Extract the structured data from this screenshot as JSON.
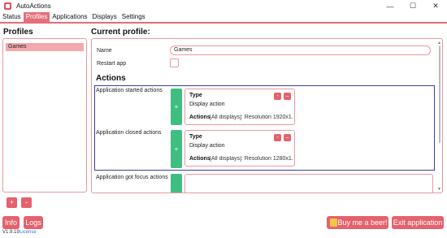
{
  "window": {
    "title": "AutoActions"
  },
  "menu": {
    "items": [
      {
        "label": "Status"
      },
      {
        "label": "Profiles"
      },
      {
        "label": "Applications"
      },
      {
        "label": "Displays"
      },
      {
        "label": "Settings"
      }
    ],
    "active_index": 1
  },
  "profiles": {
    "heading": "Profiles",
    "items": [
      {
        "label": "Games"
      }
    ],
    "add_label": "+",
    "remove_label": "-"
  },
  "current_profile": {
    "heading": "Current profile:",
    "name_label": "Name",
    "name_value": "Games",
    "restart_label": "Restart app",
    "restart_checked": false,
    "actions_heading": "Actions",
    "groups": [
      {
        "label": "Application started actions",
        "add_label": "+",
        "card": {
          "type_label": "Type",
          "type_value": "Display action",
          "actions_label": "Actions",
          "actions_value": "[All displays]: Resolution 1920x1...",
          "minus_label": "-",
          "collapse_label": "–"
        }
      },
      {
        "label": "Application closed actions",
        "add_label": "+",
        "card": {
          "type_label": "Type",
          "type_value": "Display action",
          "actions_label": "Actions",
          "actions_value": "[All displays]: Resolution 1280x1...",
          "minus_label": "-",
          "collapse_label": "–"
        }
      },
      {
        "label": "Application got focus actions",
        "add_label": ""
      }
    ]
  },
  "footer": {
    "info_label": "Info",
    "logs_label": "Logs",
    "beer_label": "Buy me a beer!",
    "exit_label": "Exit application",
    "version": "V1.9.19",
    "license_label": "License"
  },
  "colors": {
    "accent": "#e4626d",
    "accent_light": "#f2a8ad",
    "border": "#e79aa1",
    "add_green": "#3fbf7f",
    "selection": "#3b3fa6"
  }
}
